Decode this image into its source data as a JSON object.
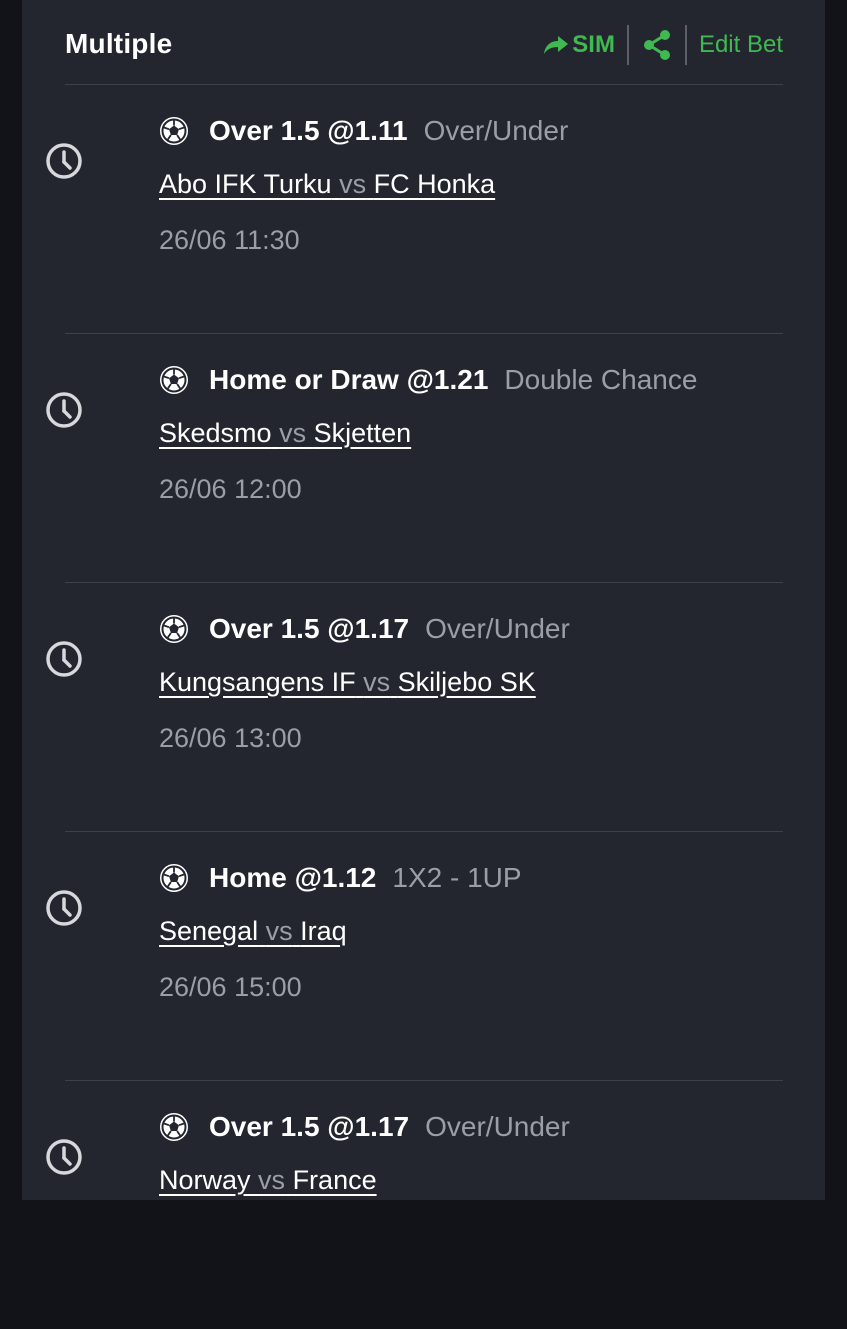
{
  "header": {
    "title": "Multiple",
    "sim_label": "SIM",
    "edit_label": "Edit Bet"
  },
  "colors": {
    "accent": "#3fb950",
    "panel": "#23262e",
    "background": "#111318",
    "muted": "#9a9ea6"
  },
  "icons": {
    "sim": "share-forward-icon",
    "share": "share-nodes-icon",
    "time": "clock-icon",
    "sport": "soccer-ball-icon"
  },
  "bets": [
    {
      "selection": "Over 1.5 @1.11",
      "market": "Over/Under",
      "home": "Abo IFK Turku",
      "vs": "vs",
      "away": "FC Honka",
      "datetime": "26/06 11:30"
    },
    {
      "selection": "Home or Draw @1.21",
      "market": "Double Chance",
      "home": "Skedsmo",
      "vs": "vs",
      "away": "Skjetten",
      "datetime": "26/06 12:00"
    },
    {
      "selection": "Over 1.5 @1.17",
      "market": "Over/Under",
      "home": "Kungsangens IF",
      "vs": "vs",
      "away": "Skiljebo SK",
      "datetime": "26/06 13:00"
    },
    {
      "selection": "Home @1.12",
      "market": "1X2  -  1UP",
      "home": "Senegal",
      "vs": "vs",
      "away": "Iraq",
      "datetime": "26/06 15:00"
    },
    {
      "selection": "Over 1.5 @1.17",
      "market": "Over/Under",
      "home": "Norway",
      "vs": "vs",
      "away": "France",
      "datetime": ""
    }
  ]
}
